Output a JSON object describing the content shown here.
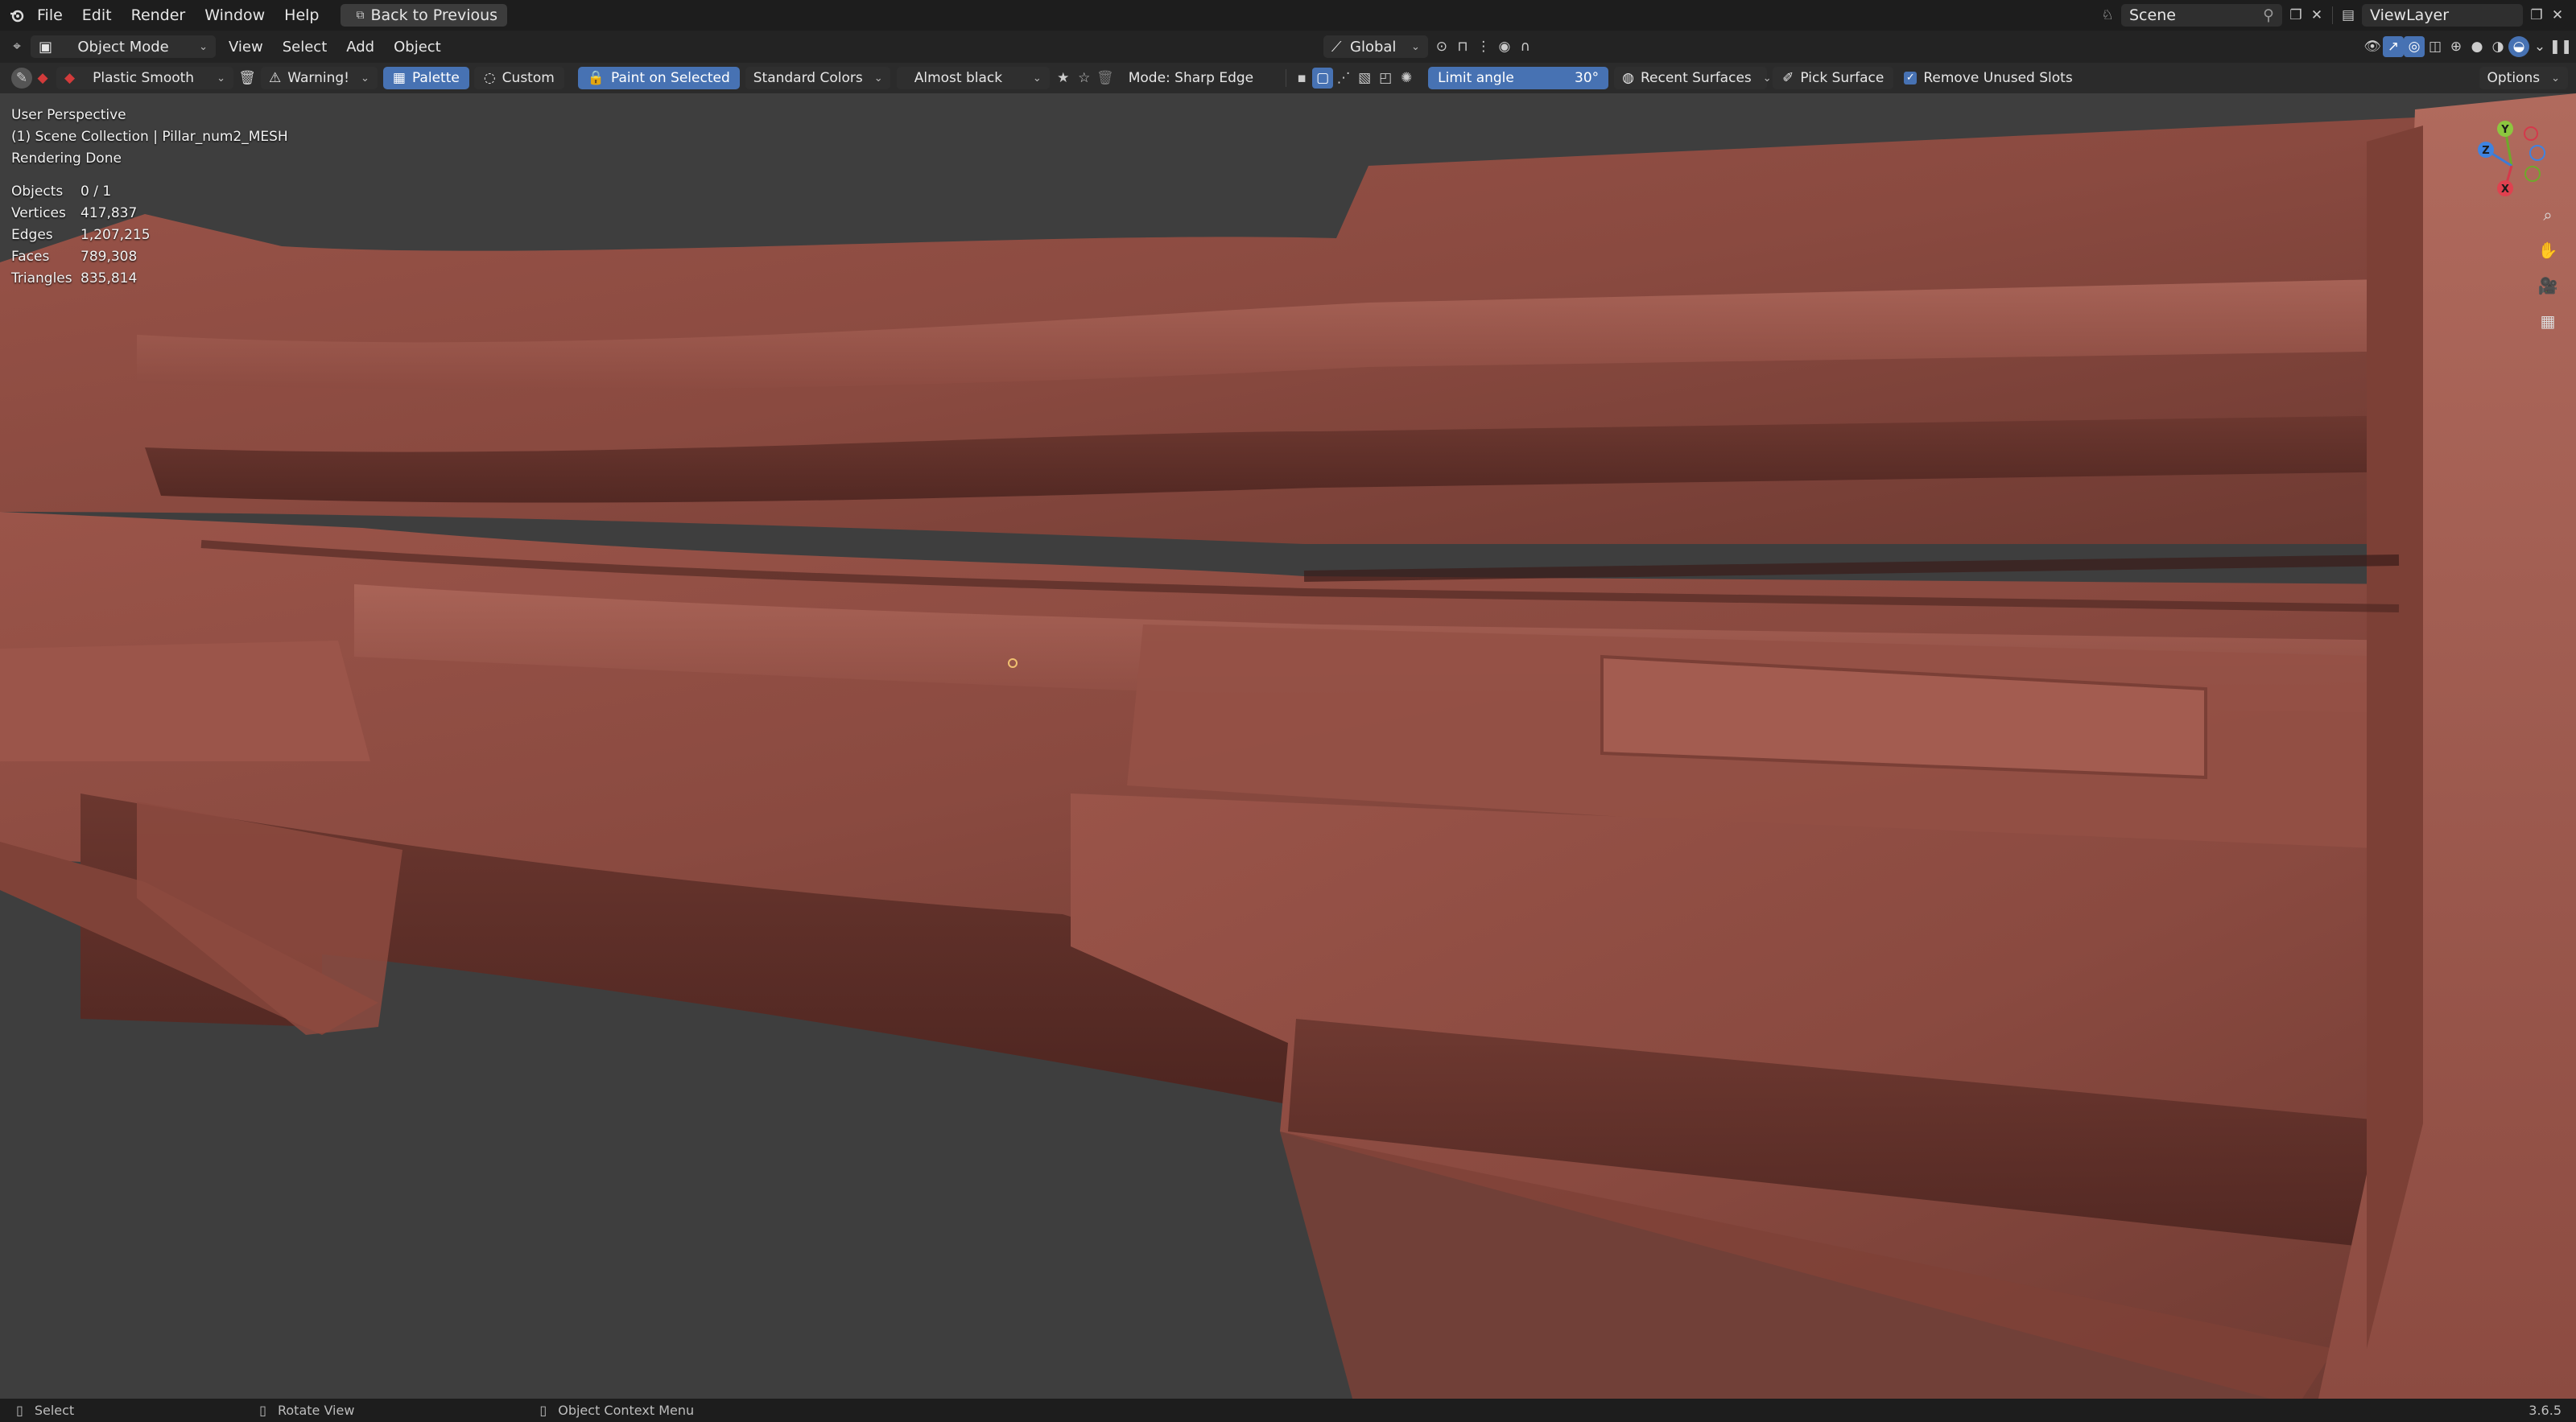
{
  "topbar": {
    "menus": [
      "File",
      "Edit",
      "Render",
      "Window",
      "Help"
    ],
    "back_button": "Back to Previous",
    "scene": "Scene",
    "view_layer": "ViewLayer"
  },
  "header": {
    "mode": "Object Mode",
    "menus": [
      "View",
      "Select",
      "Add",
      "Object"
    ],
    "transform_orientation": "Global"
  },
  "tool_settings": {
    "brush": "Plastic Smooth",
    "warning": "Warning!",
    "palette": "Palette",
    "custom": "Custom",
    "paint_on_selected": "Paint on Selected",
    "color_set": "Standard Colors",
    "color": "Almost black",
    "mode": "Mode: Sharp Edge",
    "limit_angle_label": "Limit angle",
    "limit_angle_value": "30°",
    "recent_surfaces": "Recent Surfaces",
    "pick_surface": "Pick Surface",
    "remove_unused_slots": "Remove Unused Slots",
    "options": "Options"
  },
  "viewport": {
    "perspective": "User Perspective",
    "collection": "(1) Scene Collection | Pillar_num2_MESH",
    "render_status": "Rendering Done",
    "stats": [
      {
        "label": "Objects",
        "value": "0 / 1"
      },
      {
        "label": "Vertices",
        "value": "417,837"
      },
      {
        "label": "Edges",
        "value": "1,207,215"
      },
      {
        "label": "Faces",
        "value": "789,308"
      },
      {
        "label": "Triangles",
        "value": "835,814"
      }
    ],
    "gizmo_axes": [
      "Y",
      "Z",
      "X"
    ],
    "mesh_color": "#8a4a40"
  },
  "statusbar": {
    "select": "Select",
    "rotate_view": "Rotate View",
    "context_menu": "Object Context Menu",
    "version": "3.6.5"
  }
}
